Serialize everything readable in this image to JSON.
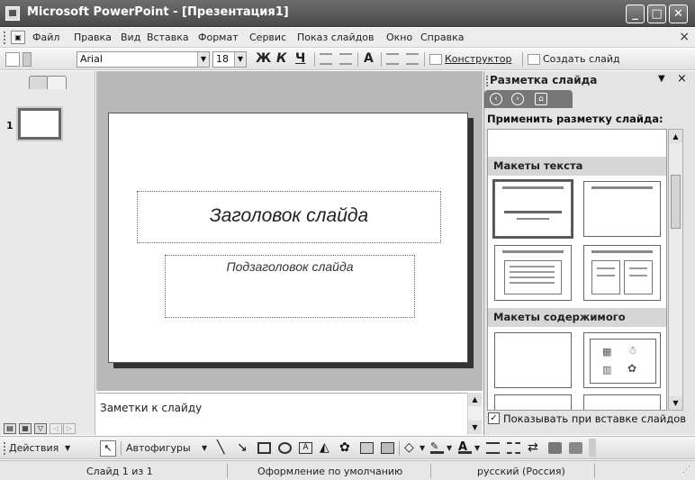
{
  "window": {
    "title": "Microsoft PowerPoint - [Презентация1]",
    "min_label": "_",
    "max_label": "□",
    "close_label": "✕"
  },
  "menu": {
    "items": [
      "Файл",
      "Правка",
      "Вид",
      "Вставка",
      "Формат",
      "Сервис",
      "Показ слайдов",
      "Окно",
      "Справка"
    ],
    "close_label": "×"
  },
  "format_toolbar": {
    "font_name": "Arial",
    "font_size": "18",
    "bold": "Ж",
    "italic": "К",
    "underline": "Ч",
    "grow_font": "A",
    "designer_label": "Конструктор",
    "new_slide_label": "Создать слайд"
  },
  "slides_pane": {
    "slide_number": "1"
  },
  "slide": {
    "title_placeholder": "Заголовок слайда",
    "subtitle_placeholder": "Подзаголовок слайда"
  },
  "notes": {
    "placeholder": "Заметки к слайду"
  },
  "task_pane": {
    "title": "Разметка слайда",
    "apply_label": "Применить разметку слайда:",
    "section_text": "Макеты текста",
    "section_content": "Макеты содержимого",
    "show_on_insert_label": "Показывать при вставке слайдов",
    "show_on_insert_checked": true
  },
  "drawing_toolbar": {
    "actions_label": "Действия",
    "autoshapes_label": "Автофигуры"
  },
  "status": {
    "slide_info": "Слайд 1 из 1",
    "design": "Оформление по умолчанию",
    "language": "русский (Россия)"
  },
  "colors": {
    "title_bar": "#5a5a5a",
    "workspace": "#b8b8b8",
    "task_pane": "#e4e4e4"
  }
}
